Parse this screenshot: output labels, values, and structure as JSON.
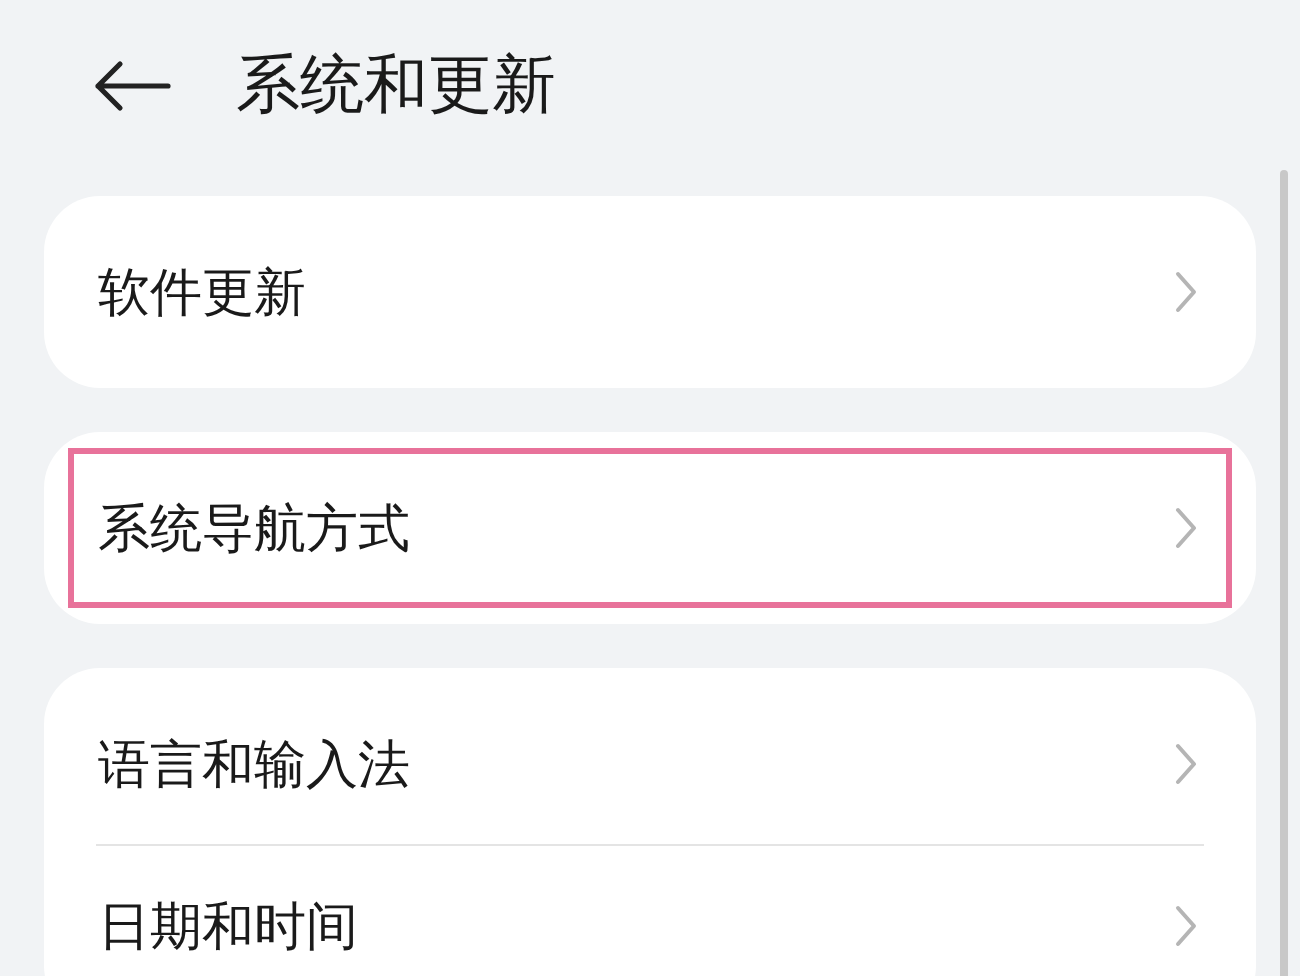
{
  "header": {
    "title": "系统和更新"
  },
  "groups": [
    {
      "items": [
        {
          "label": "软件更新",
          "highlighted": false
        }
      ]
    },
    {
      "items": [
        {
          "label": "系统导航方式",
          "highlighted": true
        }
      ]
    },
    {
      "items": [
        {
          "label": "语言和输入法",
          "highlighted": false
        },
        {
          "label": "日期和时间",
          "highlighted": false
        }
      ]
    }
  ]
}
